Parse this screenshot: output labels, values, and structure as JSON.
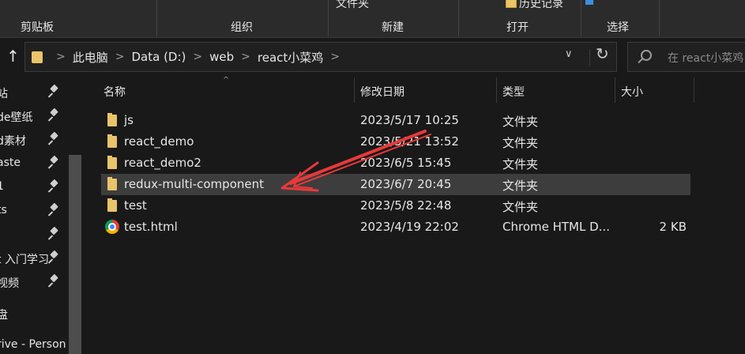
{
  "ribbon": {
    "groups": [
      {
        "label": "剪贴板"
      },
      {
        "label": "组织"
      },
      {
        "label": "新建"
      },
      {
        "label": "打开"
      },
      {
        "label": "选择"
      }
    ],
    "top_new_label": "文件夹",
    "top_history_label": "历史记录"
  },
  "address": {
    "breadcrumbs": [
      "此电脑",
      "Data (D:)",
      "web",
      "react小菜鸡"
    ],
    "search_placeholder": "在 react小菜鸡"
  },
  "sidebar": {
    "items": [
      {
        "label": "站",
        "pinned": true
      },
      {
        "label": "de壁纸",
        "pinned": true
      },
      {
        "label": "d素材",
        "pinned": true
      },
      {
        "label": "aste",
        "pinned": true
      },
      {
        "label": "1",
        "pinned": true
      },
      {
        "label": "ts",
        "pinned": true
      },
      {
        "label": "",
        "pinned": true
      },
      {
        "label": "t 入门学习",
        "pinned": true
      },
      {
        "label": "视频",
        "pinned": true
      },
      {
        "label": "盘",
        "pinned": false
      },
      {
        "label": "rive - Person",
        "pinned": false
      }
    ]
  },
  "columns": {
    "name": "名称",
    "modified": "修改日期",
    "type": "类型",
    "size": "大小"
  },
  "files": [
    {
      "name": "js",
      "modified": "2023/5/17 10:25",
      "type": "文件夹",
      "size": "",
      "icon": "folder-icon",
      "selected": false
    },
    {
      "name": "react_demo",
      "modified": "2023/5/21 13:52",
      "type": "文件夹",
      "size": "",
      "icon": "folder-icon",
      "selected": false
    },
    {
      "name": "react_demo2",
      "modified": "2023/6/5 15:45",
      "type": "文件夹",
      "size": "",
      "icon": "folder-icon",
      "selected": false
    },
    {
      "name": "redux-multi-component",
      "modified": "2023/6/7 20:45",
      "type": "文件夹",
      "size": "",
      "icon": "folder-icon",
      "selected": true
    },
    {
      "name": "test",
      "modified": "2023/5/8 22:48",
      "type": "文件夹",
      "size": "",
      "icon": "folder-icon",
      "selected": false
    },
    {
      "name": "test.html",
      "modified": "2023/4/19 22:02",
      "type": "Chrome HTML D...",
      "size": "2 KB",
      "icon": "chrome-icon",
      "selected": false
    }
  ],
  "colors": {
    "background": "#191919",
    "ribbon": "#2b2b2b",
    "selected_row": "#3d3d3d",
    "folder": "#e9c46a",
    "annotation_arrow": "#e8393a"
  }
}
